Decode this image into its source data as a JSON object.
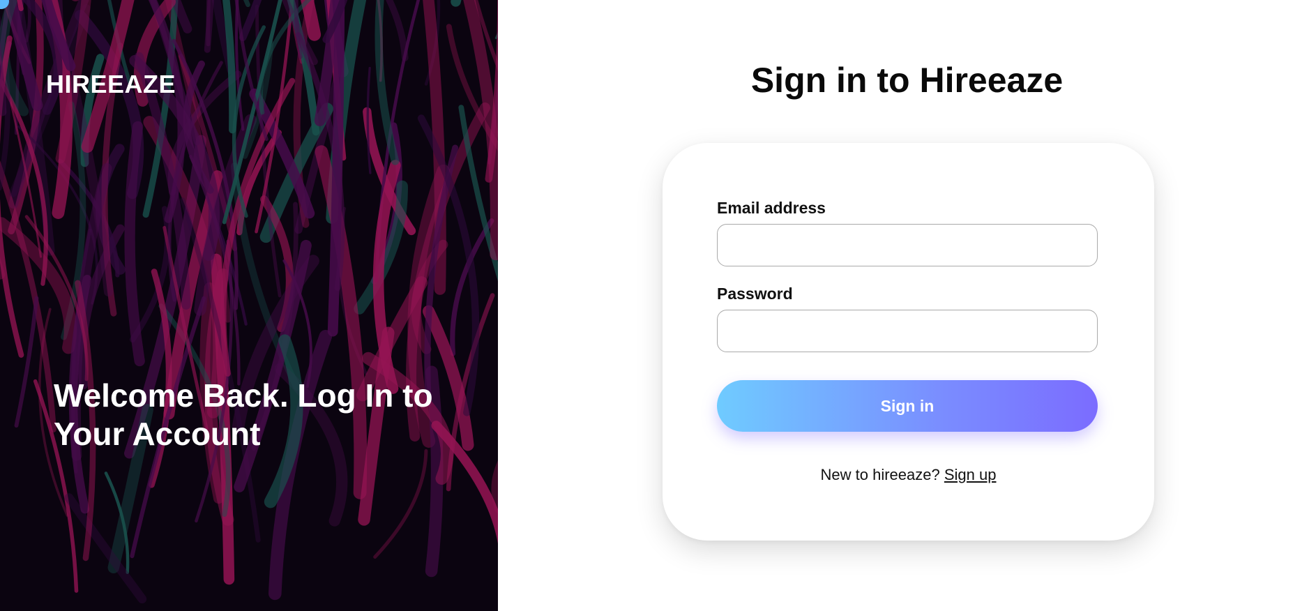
{
  "hero": {
    "brand": "HIREEAZE",
    "headline": "Welcome Back. Log In to Your Account",
    "palette": [
      "#0b0410",
      "#5a0f5e",
      "#c21a6a",
      "#1e6b62",
      "#3b0c4a"
    ]
  },
  "form": {
    "title": "Sign in to Hireeaze",
    "email_label": "Email address",
    "email_value": "",
    "password_label": "Password",
    "password_value": "",
    "submit_label": "Sign in",
    "signup_prompt": "New to hireeaze?",
    "signup_link": "Sign up"
  },
  "colors": {
    "button_gradient_start": "#6fcbff",
    "button_gradient_end": "#7b6cff",
    "corner_dot": "#5fb8ff"
  }
}
